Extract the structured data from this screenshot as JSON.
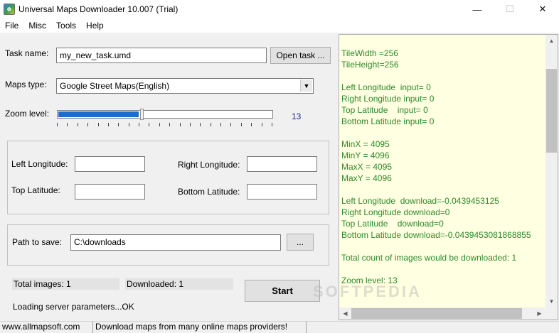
{
  "window": {
    "title": "Universal Maps Downloader 10.007 (Trial)",
    "minimize_icon": "minimize-icon",
    "maximize_icon": "maximize-icon",
    "close_icon": "close-icon"
  },
  "menu": [
    "File",
    "Misc",
    "Tools",
    "Help"
  ],
  "task": {
    "label": "Task name:",
    "value": "my_new_task.umd",
    "open_button": "Open task ..."
  },
  "maps": {
    "label": "Maps type:",
    "selected": "Google Street Maps(English)"
  },
  "zoom": {
    "label": "Zoom level:",
    "value": "13",
    "min": 0,
    "max": 21,
    "accent_color": "#1e6bd0"
  },
  "coords": {
    "left_longitude_label": "Left Longitude:",
    "right_longitude_label": "Right Longitude:",
    "top_latitude_label": "Top Latitude:",
    "bottom_latitude_label": "Bottom Latitude:",
    "left_longitude_value": "",
    "right_longitude_value": "",
    "top_latitude_value": "",
    "bottom_latitude_value": ""
  },
  "path": {
    "label": "Path to save:",
    "value": "C:\\downloads",
    "browse_button": "..."
  },
  "status": {
    "total_images": "Total images: 1",
    "downloaded": "Downloaded: 1",
    "start_button": "Start",
    "message": "Loading server parameters...OK"
  },
  "log": {
    "text_color": "#2d8a2d",
    "background": "#ffffe1",
    "lines": [
      "TileWidth =256",
      "TileHeight=256",
      "",
      "Left Longitude  input= 0",
      "Right Longitude input= 0",
      "Top Latitude    input= 0",
      "Bottom Latitude input= 0",
      "",
      "MinX = 4095",
      "MinY = 4096",
      "MaxX = 4095",
      "MaxY = 4096",
      "",
      "Left Longitude  download=-0.0439453125",
      "Right Longitude download=0",
      "Top Latitude    download=0",
      "Bottom Latitude download=-0.0439453081868855",
      "",
      "Total count of images would be downloaded: 1",
      "",
      "Zoom level: 13"
    ]
  },
  "statusbar": {
    "website": "www.allmapsoft.com",
    "tagline": "Download maps from many online maps providers!"
  },
  "watermark": "SOFTPEDIA"
}
